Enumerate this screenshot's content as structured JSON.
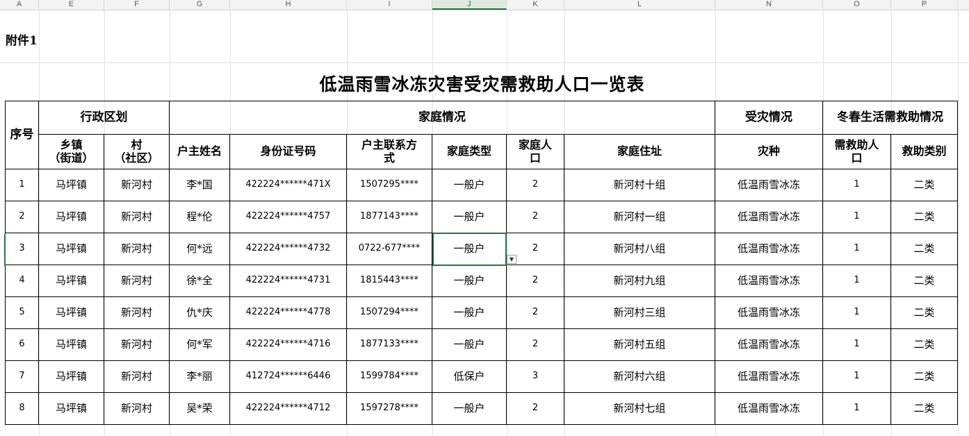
{
  "column_letters": [
    "A",
    "E",
    "F",
    "G",
    "H",
    "I",
    "J",
    "K",
    "L",
    "N",
    "O",
    "P"
  ],
  "selected_column": "J",
  "attachment_label": "附件1",
  "title": "低温雨雪冰冻灾害受灾需救助人口一览表",
  "headers": {
    "seq": "序号",
    "admin_region": "行政区划",
    "family_info": "家庭情况",
    "disaster_info": "受灾情况",
    "winter_spring": "冬春生活需救助情况",
    "town": "乡镇\n（街道）",
    "village": "村\n（社区）",
    "head_name": "户主姓名",
    "id_number": "身份证号码",
    "contact": "户主联系方\n式",
    "family_type": "家庭类型",
    "family_size": "家庭人\n口",
    "address": "家庭住址",
    "disaster_type": "灾种",
    "need_aid": "需救助人\n口",
    "aid_category": "救助类别"
  },
  "rows": [
    {
      "seq": "1",
      "town": "马坪镇",
      "village": "新河村",
      "name": "李*国",
      "id": "422224******471X",
      "phone": "1507295****",
      "type": "一般户",
      "size": "2",
      "address": "新河村十组",
      "disaster": "低温雨雪冰冻",
      "need": "1",
      "category": "二类"
    },
    {
      "seq": "2",
      "town": "马坪镇",
      "village": "新河村",
      "name": "程*伦",
      "id": "422224******4757",
      "phone": "1877143****",
      "type": "一般户",
      "size": "2",
      "address": "新河村一组",
      "disaster": "低温雨雪冰冻",
      "need": "1",
      "category": "二类"
    },
    {
      "seq": "3",
      "town": "马坪镇",
      "village": "新河村",
      "name": "何*远",
      "id": "422224******4732",
      "phone": "0722-677****",
      "type": "一般户",
      "size": "2",
      "address": "新河村八组",
      "disaster": "低温雨雪冰冻",
      "need": "1",
      "category": "二类"
    },
    {
      "seq": "4",
      "town": "马坪镇",
      "village": "新河村",
      "name": "徐*全",
      "id": "422224******4731",
      "phone": "1815443****",
      "type": "一般户",
      "size": "2",
      "address": "新河村九组",
      "disaster": "低温雨雪冰冻",
      "need": "1",
      "category": "二类"
    },
    {
      "seq": "5",
      "town": "马坪镇",
      "village": "新河村",
      "name": "仇*庆",
      "id": "422224******4778",
      "phone": "1507294****",
      "type": "一般户",
      "size": "2",
      "address": "新河村三组",
      "disaster": "低温雨雪冰冻",
      "need": "1",
      "category": "二类"
    },
    {
      "seq": "6",
      "town": "马坪镇",
      "village": "新河村",
      "name": "何*军",
      "id": "422224******4716",
      "phone": "1877133****",
      "type": "一般户",
      "size": "2",
      "address": "新河村五组",
      "disaster": "低温雨雪冰冻",
      "need": "1",
      "category": "二类"
    },
    {
      "seq": "7",
      "town": "马坪镇",
      "village": "新河村",
      "name": "李*丽",
      "id": "412724******6446",
      "phone": "1599784****",
      "type": "低保户",
      "size": "3",
      "address": "新河村六组",
      "disaster": "低温雨雪冰冻",
      "need": "1",
      "category": "二类"
    },
    {
      "seq": "8",
      "town": "马坪镇",
      "village": "新河村",
      "name": "吴*荣",
      "id": "422224******4712",
      "phone": "1597278****",
      "type": "一般户",
      "size": "2",
      "address": "新河村七组",
      "disaster": "低温雨雪冰冻",
      "need": "1",
      "category": "二类"
    }
  ],
  "colors": {
    "selection": "#217346",
    "grid": "#e2e2e2",
    "header_bg": "#f3f3f3"
  },
  "icons": {
    "dropdown": "chevron-down-icon"
  }
}
